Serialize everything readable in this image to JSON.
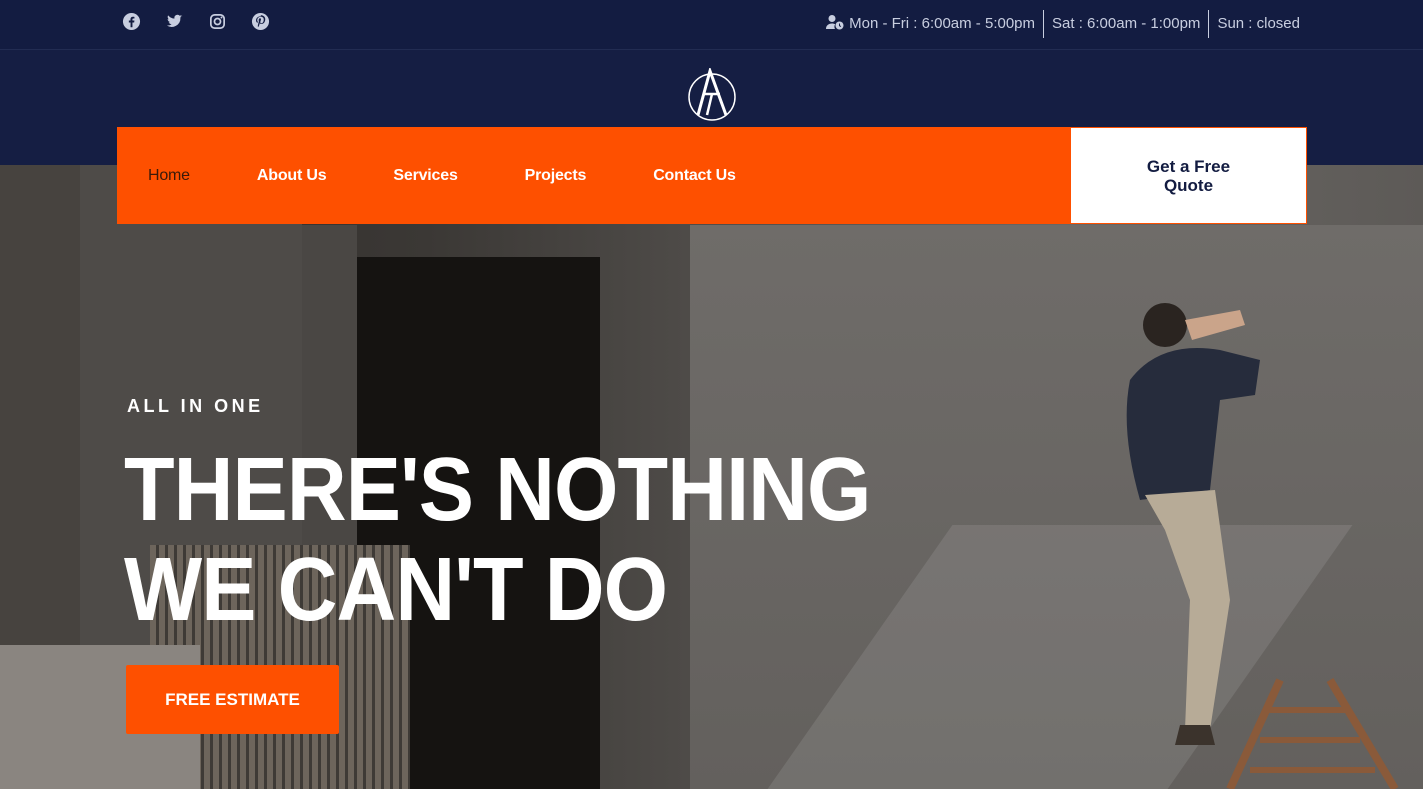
{
  "topbar": {
    "socials": [
      "facebook-icon",
      "twitter-icon",
      "instagram-icon",
      "pinterest-icon"
    ],
    "hours": {
      "weekdays": "Mon - Fri : 6:00am - 5:00pm",
      "saturday": "Sat : 6:00am - 1:00pm",
      "sunday": "Sun : closed"
    }
  },
  "nav": {
    "items": [
      {
        "label": "Home",
        "active": true
      },
      {
        "label": "About Us"
      },
      {
        "label": "Services"
      },
      {
        "label": "Projects"
      },
      {
        "label": "Contact Us"
      }
    ],
    "quote_label": "Get a Free Quote"
  },
  "hero": {
    "eyebrow": "ALL IN ONE",
    "headline_line1": "THERE'S NOTHING",
    "headline_line2": "WE CAN'T DO",
    "cta_label": "FREE ESTIMATE"
  },
  "colors": {
    "navy": "#131c41",
    "accent": "#fe5000",
    "white": "#ffffff"
  }
}
